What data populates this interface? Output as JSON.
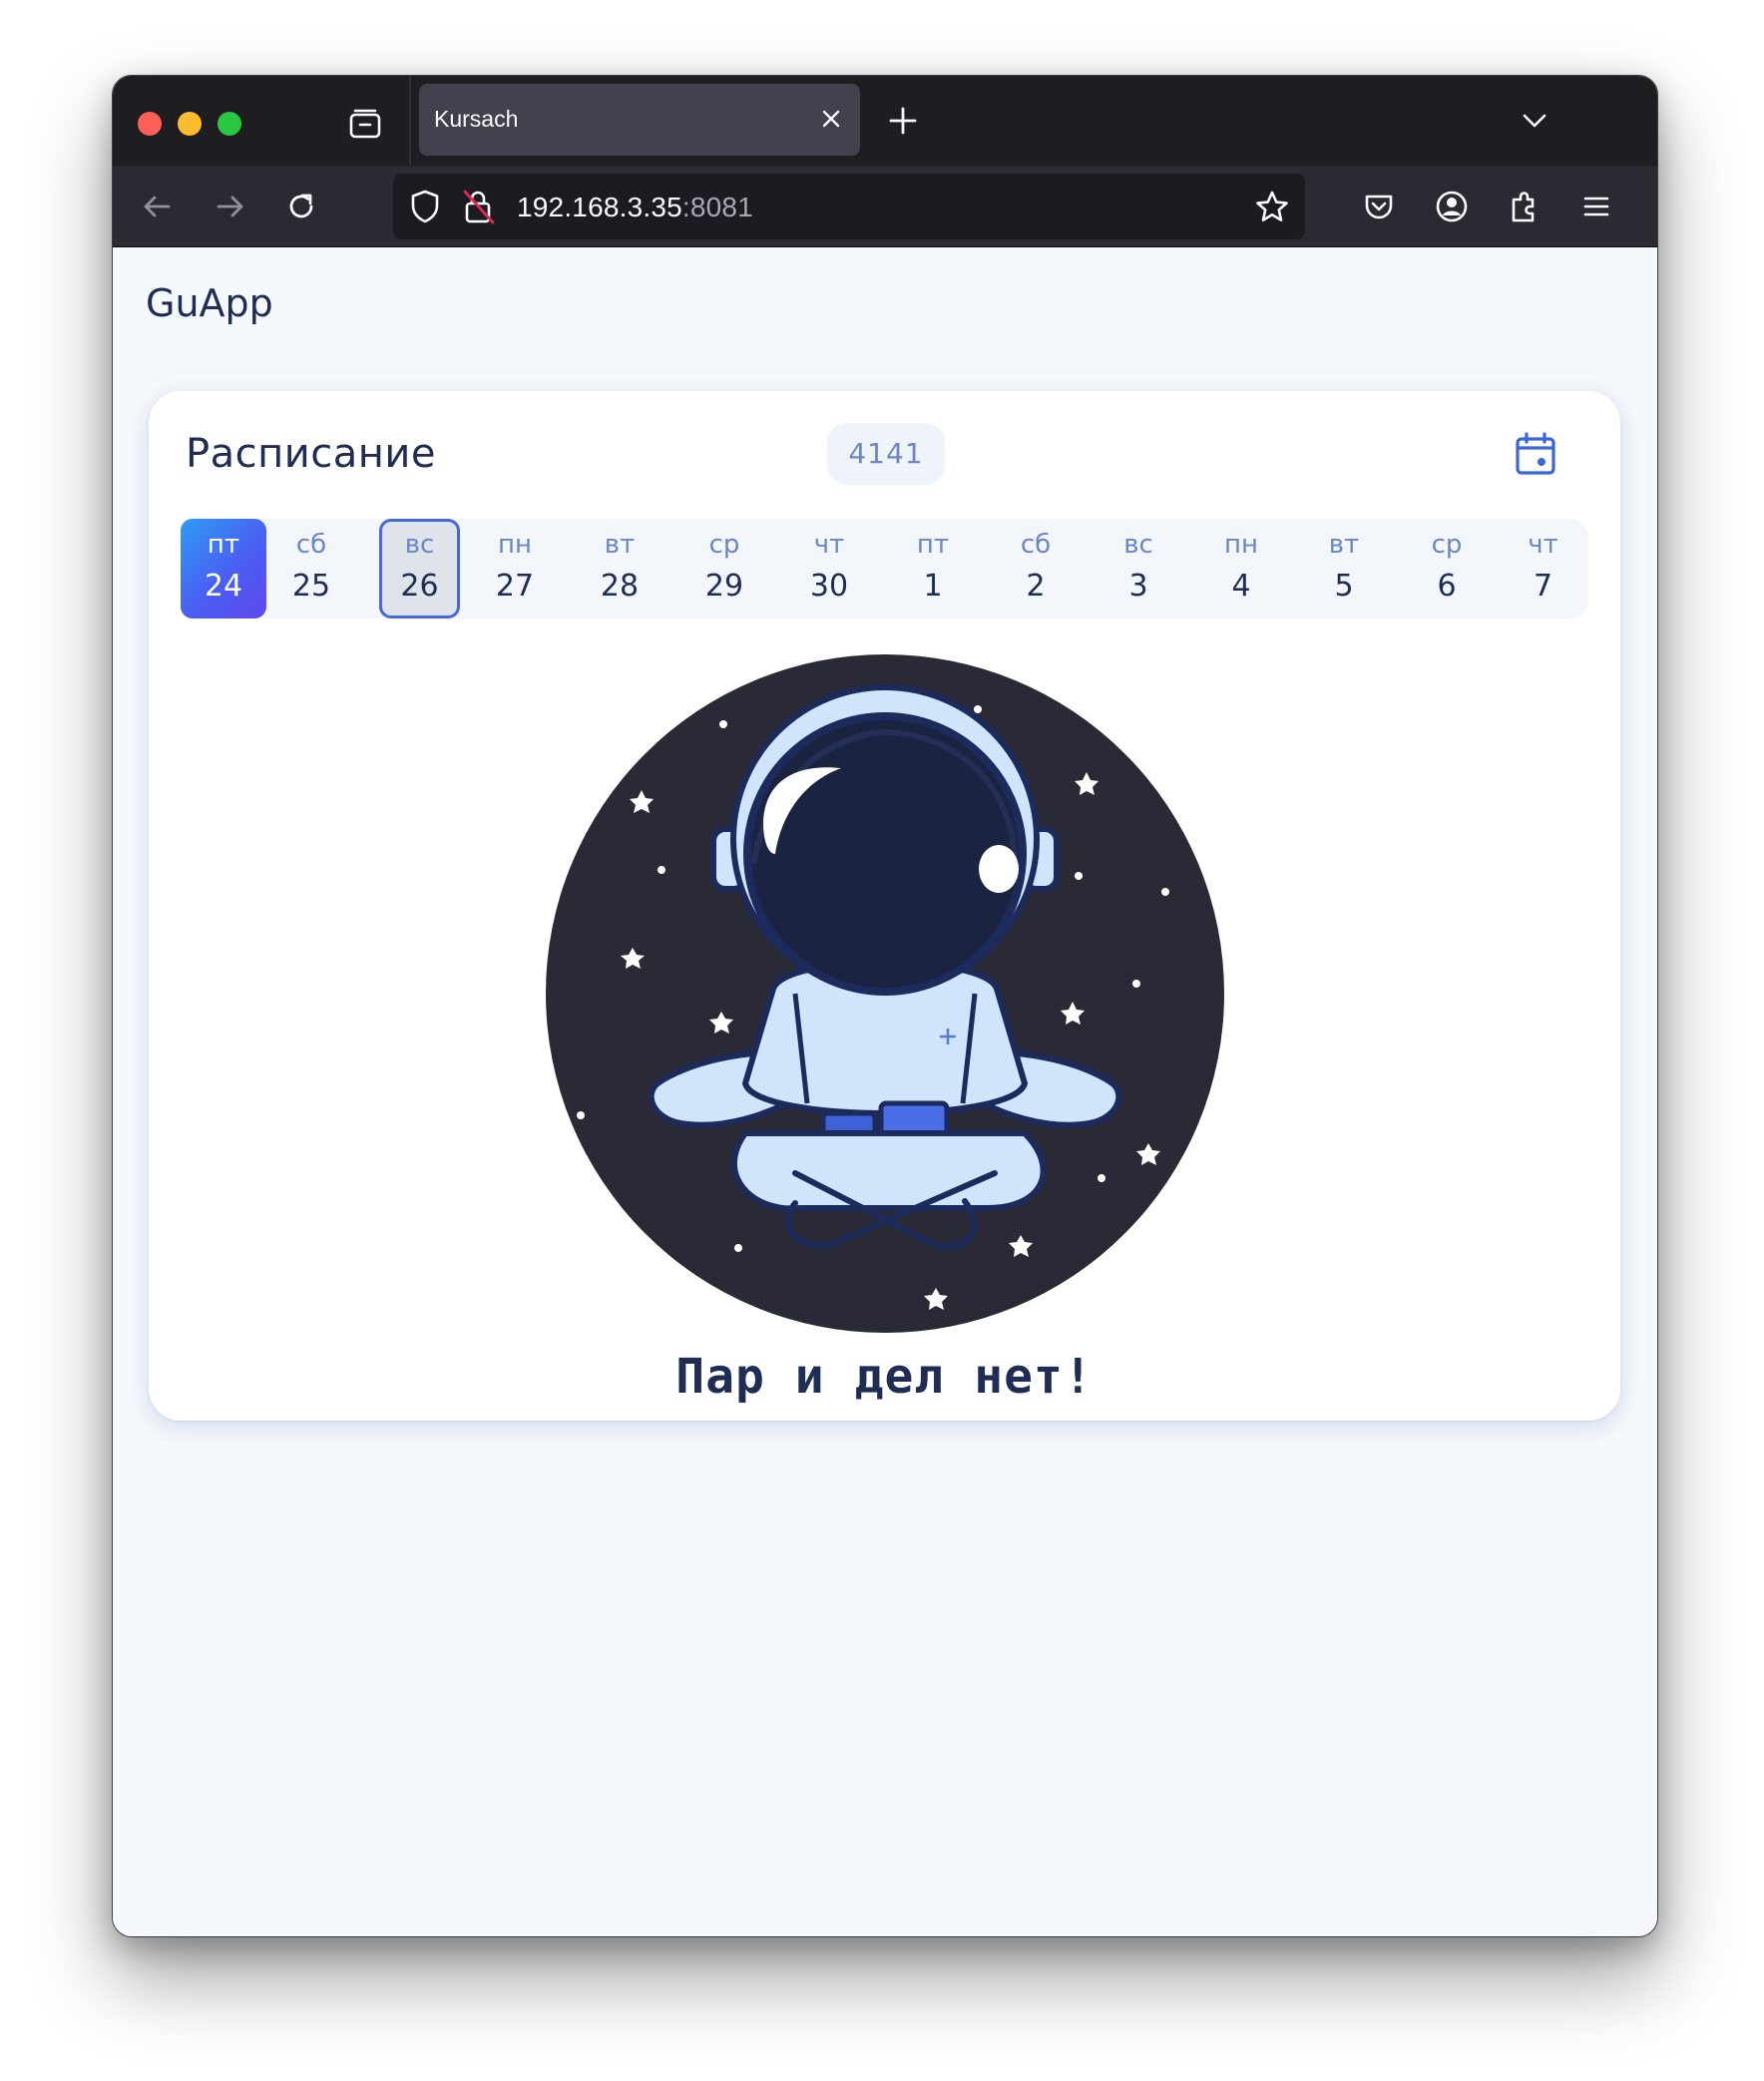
{
  "browser": {
    "tab_title": "Kursach",
    "url_host": "192.168.3.35",
    "url_port": ":8081"
  },
  "app": {
    "brand": "GuApp",
    "schedule_title": "Расписание",
    "group": "4141",
    "empty_message": "Пар и дел нет!"
  },
  "days": [
    {
      "weekday": "пт",
      "date": "24",
      "state": "selected"
    },
    {
      "weekday": "сб",
      "date": "25",
      "state": "normal"
    },
    {
      "weekday": "вс",
      "date": "26",
      "state": "today"
    },
    {
      "weekday": "пн",
      "date": "27",
      "state": "normal"
    },
    {
      "weekday": "вт",
      "date": "28",
      "state": "normal"
    },
    {
      "weekday": "ср",
      "date": "29",
      "state": "normal"
    },
    {
      "weekday": "чт",
      "date": "30",
      "state": "normal"
    },
    {
      "weekday": "пт",
      "date": "1",
      "state": "normal"
    },
    {
      "weekday": "сб",
      "date": "2",
      "state": "normal"
    },
    {
      "weekday": "вс",
      "date": "3",
      "state": "normal"
    },
    {
      "weekday": "пн",
      "date": "4",
      "state": "normal"
    },
    {
      "weekday": "вт",
      "date": "5",
      "state": "normal"
    },
    {
      "weekday": "ср",
      "date": "6",
      "state": "normal"
    },
    {
      "weekday": "чт",
      "date": "7",
      "state": "normal"
    }
  ],
  "icons": {
    "tab_manager": "tab-manager-icon",
    "tab_close": "close-icon",
    "new_tab": "plus-icon",
    "tab_list": "chevron-down-icon",
    "back": "arrow-left-icon",
    "forward": "arrow-right-icon",
    "reload": "reload-icon",
    "shield": "shield-icon",
    "insecure_lock": "insecure-lock-icon",
    "bookmark": "star-icon",
    "pocket": "pocket-icon",
    "account": "account-icon",
    "extensions": "puzzle-icon",
    "menu": "hamburger-menu-icon",
    "calendar": "calendar-icon",
    "illustration": "astronaut-illustration"
  },
  "colors": {
    "accent": "#4a5ff2",
    "text_primary": "#1f2d55",
    "text_muted": "#6b86c4",
    "browser_chrome": "#1d1d22"
  }
}
